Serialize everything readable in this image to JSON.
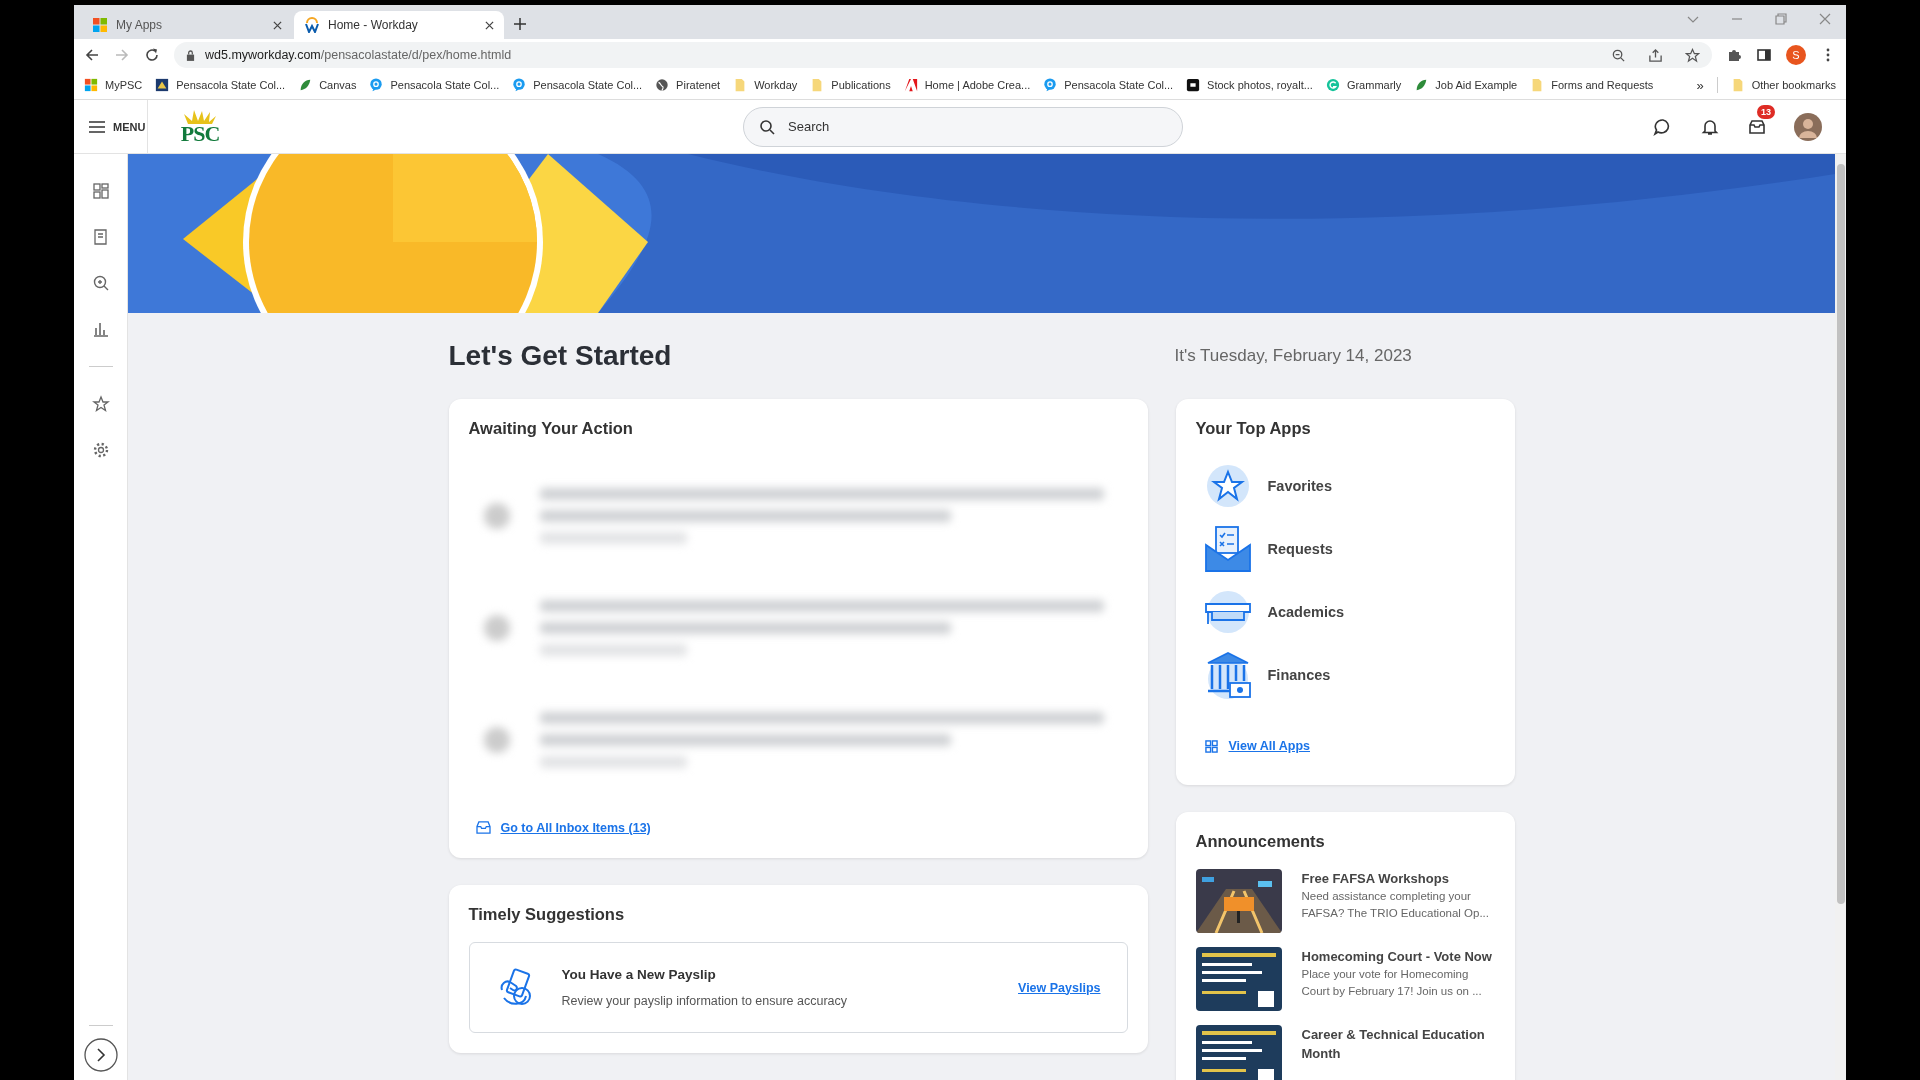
{
  "browser": {
    "tabs": [
      {
        "title": "My Apps",
        "selected": false,
        "kind": "grid"
      },
      {
        "title": "Home - Workday",
        "selected": true,
        "kind": "workday"
      }
    ],
    "url_host": "wd5.myworkday.com",
    "url_path": "/pensacolastate/d/pex/home.htmld",
    "profile_initial": "S",
    "bookmarks": [
      {
        "label": "MyPSC",
        "kind": "grid"
      },
      {
        "label": "Pensacola State Col...",
        "kind": "seal"
      },
      {
        "label": "Canvas",
        "kind": "leaf"
      },
      {
        "label": "Pensacola State Col...",
        "kind": "bubble"
      },
      {
        "label": "Pensacola State Col...",
        "kind": "bubble"
      },
      {
        "label": "Piratenet",
        "kind": "globe"
      },
      {
        "label": "Workday",
        "kind": "folder"
      },
      {
        "label": "Publications",
        "kind": "folder"
      },
      {
        "label": "Home | Adobe Crea...",
        "kind": "adobe"
      },
      {
        "label": "Pensacola State Col...",
        "kind": "bubble"
      },
      {
        "label": "Stock photos, royalt...",
        "kind": "stock"
      },
      {
        "label": "Grammarly",
        "kind": "grammarly"
      },
      {
        "label": "Job Aid Example",
        "kind": "leaf"
      },
      {
        "label": "Forms and Requests",
        "kind": "folder"
      }
    ],
    "overflow": "»",
    "other_bookmarks": "Other bookmarks"
  },
  "header": {
    "menu_label": "MENU",
    "logo": "PSC",
    "search_placeholder": "Search",
    "inbox_badge": "13"
  },
  "page_title": "Let's Get Started",
  "date": "It's Tuesday, February 14, 2023",
  "awaiting": {
    "title": "Awaiting Your Action",
    "items": [
      {
        "kind": "redacted"
      },
      {
        "kind": "redacted"
      },
      {
        "kind": "redacted"
      }
    ],
    "link": "Go to All Inbox Items (13)"
  },
  "suggestions": {
    "title": "Timely Suggestions",
    "card": {
      "title": "You Have a New Payslip",
      "text": "Review your payslip information to ensure accuracy",
      "link": "View Payslips"
    }
  },
  "top_apps": {
    "title": "Your Top Apps",
    "apps": [
      {
        "label": "Favorites",
        "kind": "star"
      },
      {
        "label": "Requests",
        "kind": "envelope"
      },
      {
        "label": "Academics",
        "kind": "cap"
      },
      {
        "label": "Finances",
        "kind": "bank"
      }
    ],
    "link": "View All Apps"
  },
  "announcements": {
    "title": "Announcements",
    "items": [
      {
        "title": "Free FAFSA Workshops",
        "text": "Need assistance completing your FAFSA? The TRIO Educational Op...",
        "kind": "road"
      },
      {
        "title": "Homecoming Court - Vote Now",
        "text": "Place your vote for Homecoming Court by February 17! Join us on ...",
        "kind": "poster"
      },
      {
        "title": "Career & Technical Education Month",
        "kind": "poster"
      }
    ]
  }
}
